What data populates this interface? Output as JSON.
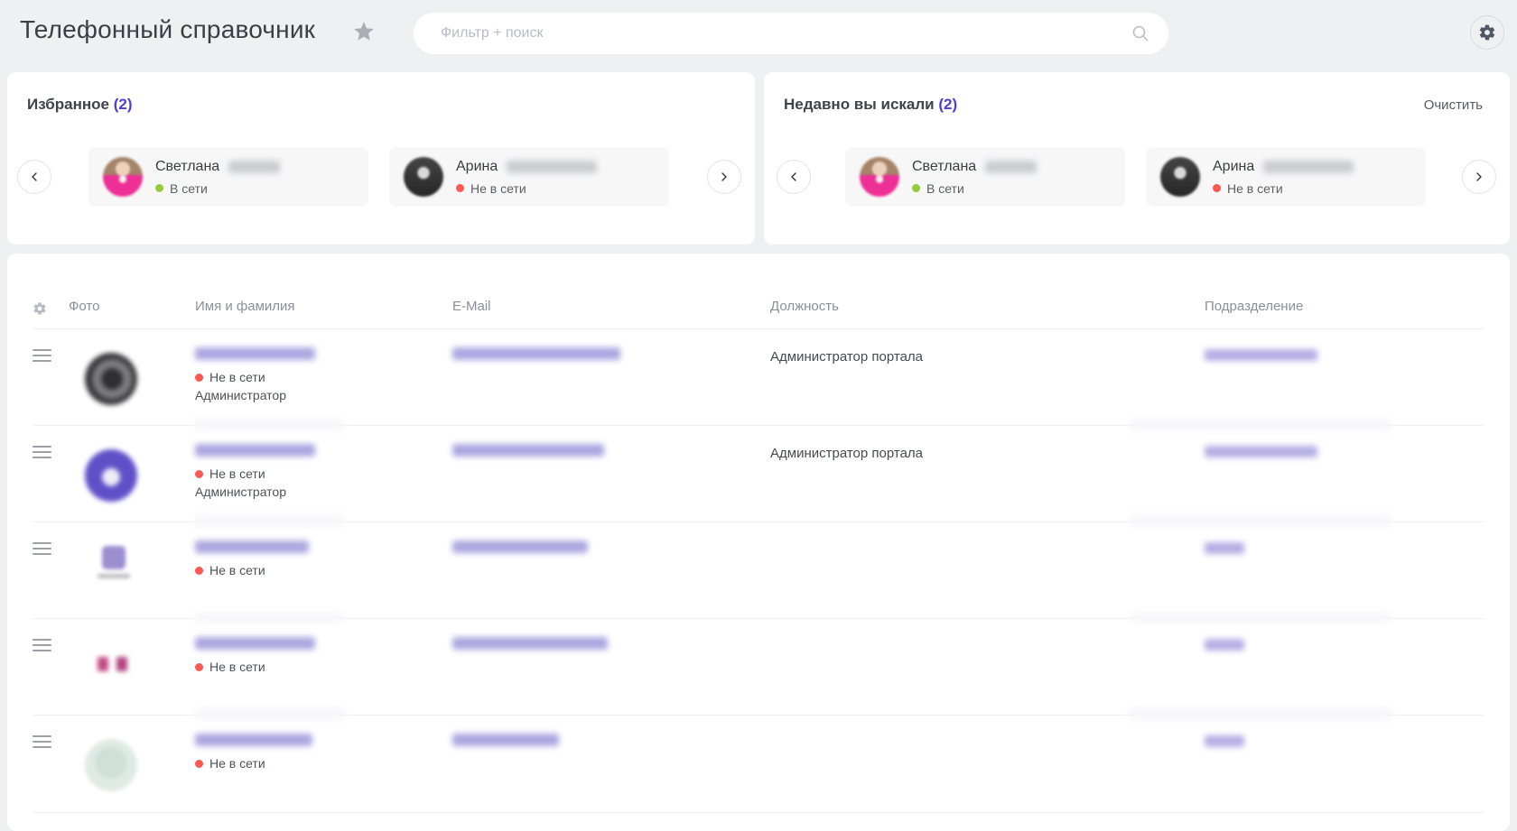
{
  "header": {
    "title": "Телефонный справочник",
    "search_placeholder": "Фильтр + поиск"
  },
  "favorites": {
    "title": "Избранное",
    "count_label": "(2)",
    "cards": [
      {
        "name": "Светлана",
        "status": "В сети",
        "online": true
      },
      {
        "name": "Арина",
        "status": "Не в сети",
        "online": false
      }
    ]
  },
  "recent": {
    "title": "Недавно вы искали",
    "count_label": "(2)",
    "clear_label": "Очистить",
    "cards": [
      {
        "name": "Светлана",
        "status": "В сети",
        "online": true
      },
      {
        "name": "Арина",
        "status": "Не в сети",
        "online": false
      }
    ]
  },
  "table": {
    "columns": [
      "Фото",
      "Имя и фамилия",
      "E-Mail",
      "Должность",
      "Подразделение"
    ],
    "rows": [
      {
        "status": "Не в сети",
        "role": "Администратор",
        "position": "Администратор портала"
      },
      {
        "status": "Не в сети",
        "role": "Администратор",
        "position": "Администратор портала"
      },
      {
        "status": "Не в сети",
        "role": "",
        "position": ""
      },
      {
        "status": "Не в сети",
        "role": "",
        "position": ""
      },
      {
        "status": "Не в сети",
        "role": "",
        "position": ""
      }
    ]
  },
  "icons": {
    "star": "favorite-star",
    "search": "magnifier",
    "settings": "gear",
    "grid_settings": "gear-outline",
    "drag": "hamburger",
    "prev": "chevron-left",
    "next": "chevron-right"
  },
  "colors": {
    "accent_purple": "#4e3fd6",
    "online_green": "#97c93d",
    "offline_red": "#ff5752",
    "page_background": "#eef0f2",
    "panel_background": "#ffffff",
    "card_background": "#f7f7f8"
  }
}
